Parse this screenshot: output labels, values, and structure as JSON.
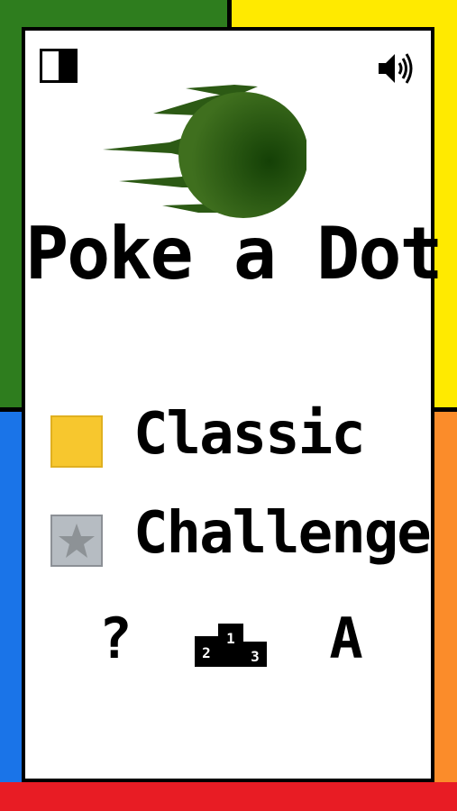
{
  "app": {
    "title": "Poke a Dot"
  },
  "colors": {
    "top_left": "#2e7d1e",
    "top_right": "#ffea00",
    "bottom_left": "#1a74e8",
    "bottom_right": "#fb8c2a",
    "bottom": "#e81c24",
    "classic_box": "#f7c72e",
    "challenge_box": "#b6bcc2"
  },
  "toolbar": {
    "contrast_icon": "contrast-icon",
    "sound_icon": "speaker-icon"
  },
  "menu": {
    "classic_label": "Classic",
    "challenge_label": "Challenge",
    "challenge_icon": "star-icon"
  },
  "bottom_bar": {
    "help_label": "?",
    "leaderboard_icon": "podium-icon",
    "leaderboard_places": [
      "2",
      "1",
      "3"
    ],
    "achievements_label": "A"
  }
}
